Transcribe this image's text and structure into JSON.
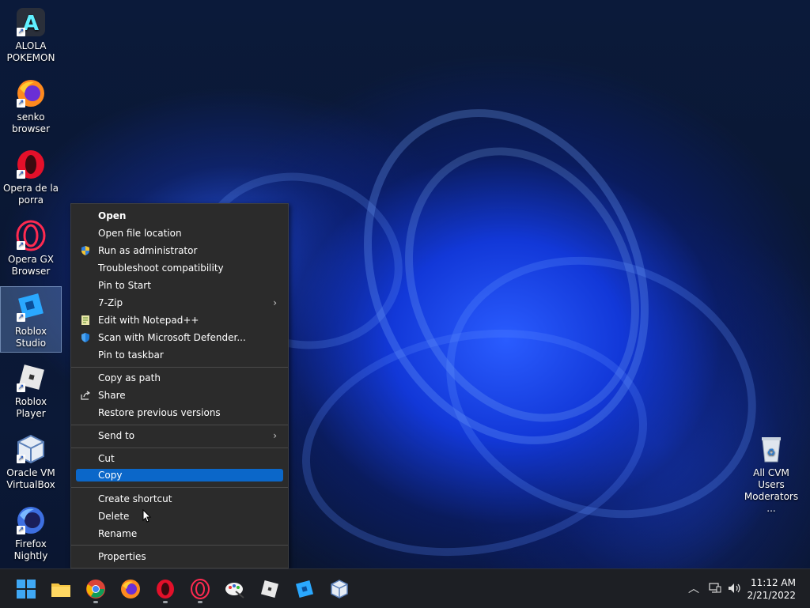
{
  "desktop": {
    "icons": [
      {
        "label": "ALOLA\nPOKEMON",
        "icon": "alola-pokemon-icon"
      },
      {
        "label": "senko\nbrowser",
        "icon": "firefox-icon"
      },
      {
        "label": "Opera de la\nporra",
        "icon": "opera-icon"
      },
      {
        "label": "Opera GX\nBrowser",
        "icon": "opera-gx-icon"
      },
      {
        "label": "Roblox Studio",
        "icon": "roblox-studio-icon"
      },
      {
        "label": "Roblox Player",
        "icon": "roblox-player-icon"
      },
      {
        "label": "Oracle VM\nVirtualBox",
        "icon": "virtualbox-icon"
      },
      {
        "label": "Firefox\nNightly",
        "icon": "firefox-nightly-icon"
      }
    ],
    "recycle_bin": {
      "label": "All CVM Users\nModerators ...",
      "icon": "recycle-bin-icon"
    }
  },
  "context_menu": {
    "items": [
      {
        "label": "Open"
      },
      {
        "label": "Open file location"
      },
      {
        "label": "Run as administrator",
        "icon": "shield-icon"
      },
      {
        "label": "Troubleshoot compatibility"
      },
      {
        "label": "Pin to Start"
      },
      {
        "label": "7-Zip"
      },
      {
        "label": "Edit with Notepad++",
        "icon": "notepad-icon"
      },
      {
        "label": "Scan with Microsoft Defender...",
        "icon": "defender-icon"
      },
      {
        "label": "Pin to taskbar"
      },
      {
        "label": "Copy as path"
      },
      {
        "label": "Share",
        "icon": "share-icon"
      },
      {
        "label": "Restore previous versions"
      },
      {
        "label": "Send to"
      },
      {
        "label": "Cut"
      },
      {
        "label": "Copy"
      },
      {
        "label": "Create shortcut"
      },
      {
        "label": "Delete"
      },
      {
        "label": "Rename"
      },
      {
        "label": "Properties"
      }
    ],
    "highlighted": "Copy"
  },
  "taskbar": {
    "apps": [
      "start-icon",
      "file-explorer-icon",
      "chrome-icon",
      "firefox-icon",
      "opera-icon",
      "opera-gx-icon",
      "paint-icon",
      "roblox-player-icon",
      "roblox-studio-icon",
      "virtualbox-icon"
    ],
    "clock": {
      "time": "11:12 AM",
      "date": "2/21/2022"
    }
  },
  "colors": {
    "accent": "#0b67c9",
    "menu_bg": "#2b2b2b",
    "taskbar_bg": "#1d1f24"
  }
}
